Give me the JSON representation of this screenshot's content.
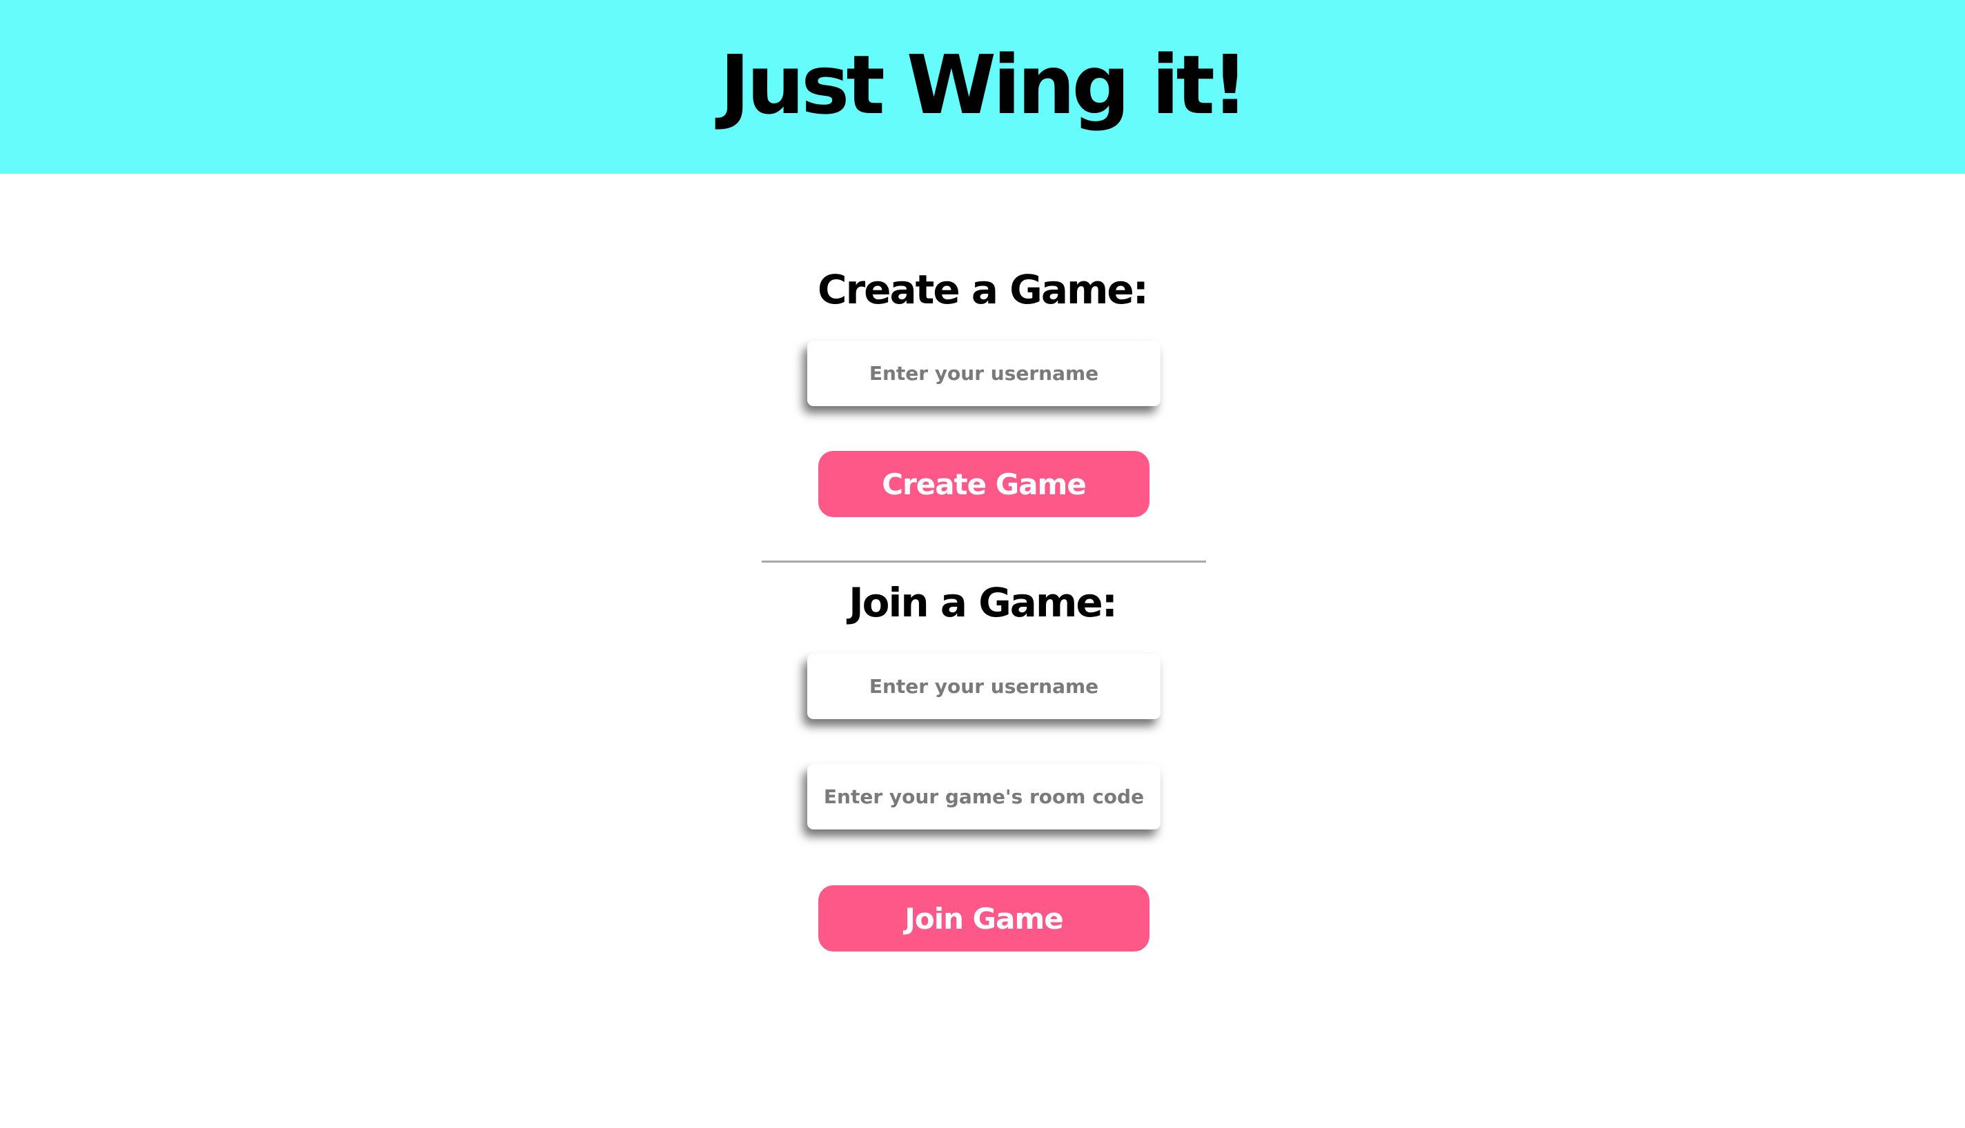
{
  "header": {
    "title": "Just Wing it!",
    "background_color": "#66fcfb"
  },
  "create": {
    "heading": "Create a Game:",
    "username_placeholder": "Enter your username",
    "username_value": "",
    "button_label": "Create Game"
  },
  "join": {
    "heading": "Join a Game:",
    "username_placeholder": "Enter your username",
    "username_value": "",
    "room_code_placeholder": "Enter your game's room code",
    "room_code_value": "",
    "button_label": "Join Game"
  },
  "colors": {
    "button": "#fe5889",
    "button_text": "#ffffff",
    "placeholder_text": "#7a7a7a"
  }
}
